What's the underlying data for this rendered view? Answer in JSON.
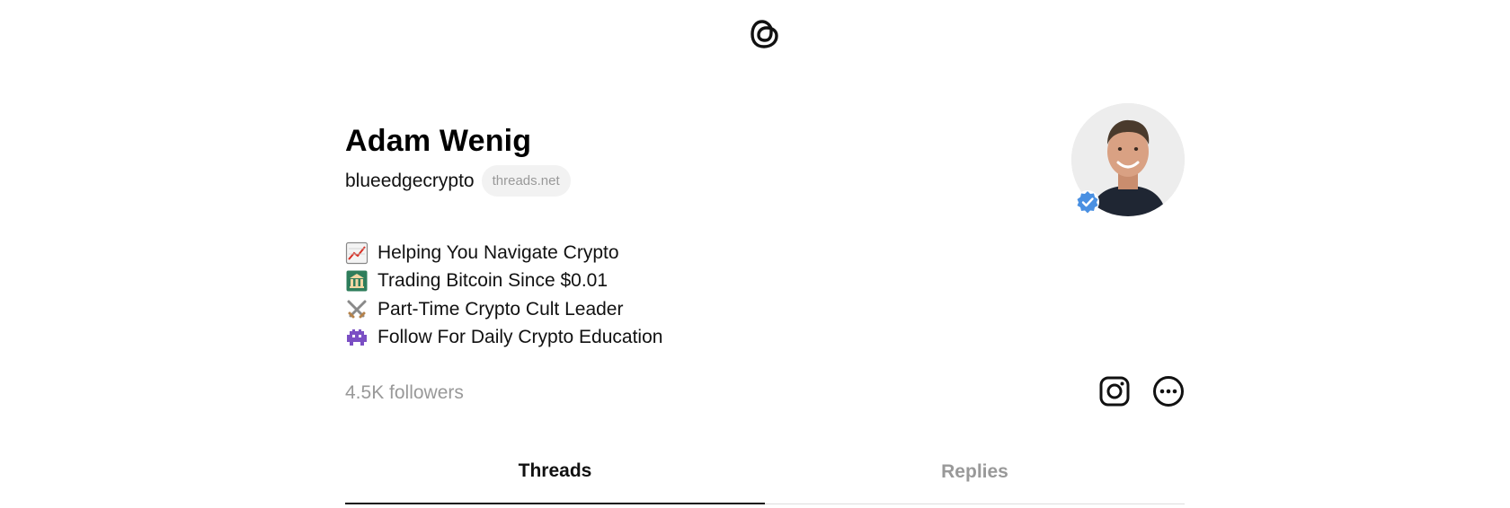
{
  "profile": {
    "name": "Adam Wenig",
    "handle": "blueedgecrypto",
    "domain_badge": "threads.net",
    "bio": [
      {
        "icon": "chart-increasing-icon",
        "text": "Helping You Navigate Crypto"
      },
      {
        "icon": "bank-icon",
        "text": "Trading Bitcoin Since $0.01"
      },
      {
        "icon": "crossed-swords-icon",
        "text": "Part-Time Crypto Cult Leader"
      },
      {
        "icon": "alien-monster-icon",
        "text": "Follow For Daily Crypto Education"
      }
    ],
    "followers": "4.5K followers"
  },
  "tabs": [
    {
      "label": "Threads",
      "active": true
    },
    {
      "label": "Replies",
      "active": false
    }
  ],
  "colors": {
    "verified_blue": "#4a90e2",
    "muted_text": "#999999",
    "text": "#111111"
  }
}
